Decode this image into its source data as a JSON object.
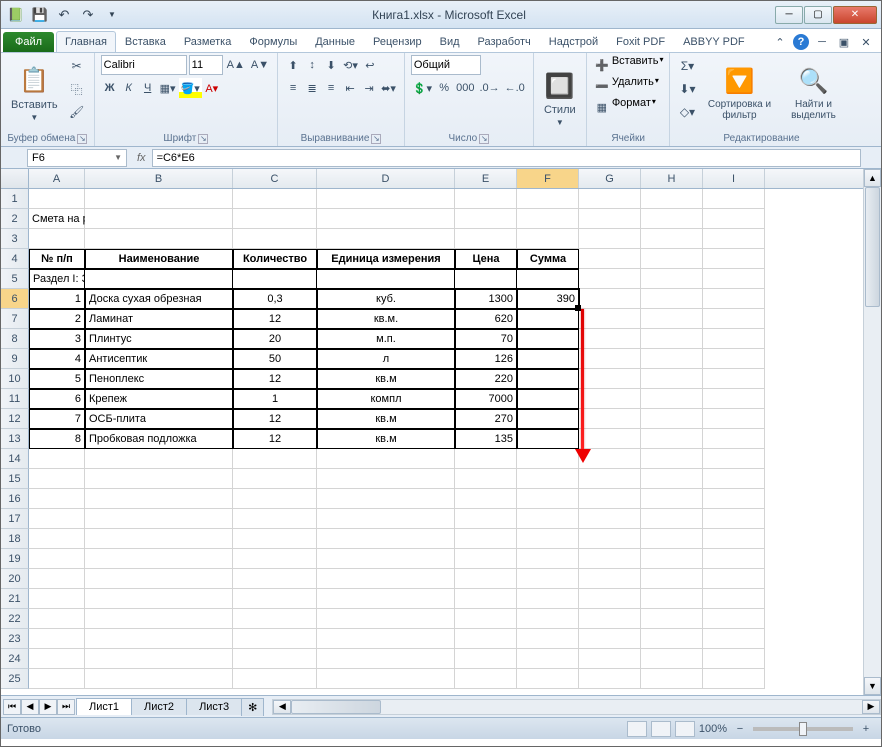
{
  "window": {
    "title": "Книга1.xlsx - Microsoft Excel"
  },
  "tabs": {
    "file": "Файл",
    "items": [
      "Главная",
      "Вставка",
      "Разметка",
      "Формулы",
      "Данные",
      "Рецензир",
      "Вид",
      "Разработч",
      "Надстрой",
      "Foxit PDF",
      "ABBYY PDF"
    ],
    "active": 0
  },
  "ribbon": {
    "clipboard": {
      "paste": "Вставить",
      "label": "Буфер обмена"
    },
    "font": {
      "name": "Calibri",
      "size": "11",
      "label": "Шрифт"
    },
    "alignment": {
      "label": "Выравнивание"
    },
    "number": {
      "format": "Общий",
      "label": "Число"
    },
    "styles": {
      "btn": "Стили",
      "label": ""
    },
    "cells": {
      "insert": "Вставить",
      "delete": "Удалить",
      "format": "Формат",
      "label": "Ячейки"
    },
    "editing": {
      "sort": "Сортировка и фильтр",
      "find": "Найти и выделить",
      "label": "Редактирование"
    }
  },
  "namebox": "F6",
  "formula": "=C6*E6",
  "columns": [
    "A",
    "B",
    "C",
    "D",
    "E",
    "F",
    "G",
    "H",
    "I"
  ],
  "selected_col": "F",
  "selected_row": 6,
  "sheet": {
    "title_row": 2,
    "title": "Смета на работы",
    "header_row": 4,
    "headers": [
      "№ п/п",
      "Наименование",
      "Количество",
      "Единица измерения",
      "Цена",
      "Сумма"
    ],
    "section_row": 5,
    "section": "Раздел I: Затраты на материалы",
    "data": [
      {
        "n": "1",
        "name": "Доска сухая обрезная",
        "qty": "0,3",
        "unit": "куб.",
        "price": "1300",
        "sum": "390"
      },
      {
        "n": "2",
        "name": "Ламинат",
        "qty": "12",
        "unit": "кв.м.",
        "price": "620",
        "sum": ""
      },
      {
        "n": "3",
        "name": "Плинтус",
        "qty": "20",
        "unit": "м.п.",
        "price": "70",
        "sum": ""
      },
      {
        "n": "4",
        "name": "Антисептик",
        "qty": "50",
        "unit": "л",
        "price": "126",
        "sum": ""
      },
      {
        "n": "5",
        "name": "Пеноплекс",
        "qty": "12",
        "unit": "кв.м",
        "price": "220",
        "sum": ""
      },
      {
        "n": "6",
        "name": "Крепеж",
        "qty": "1",
        "unit": "компл",
        "price": "7000",
        "sum": ""
      },
      {
        "n": "7",
        "name": "ОСБ-плита",
        "qty": "12",
        "unit": "кв.м",
        "price": "270",
        "sum": ""
      },
      {
        "n": "8",
        "name": "Пробковая подложка",
        "qty": "12",
        "unit": "кв.м",
        "price": "135",
        "sum": ""
      }
    ]
  },
  "sheets": [
    "Лист1",
    "Лист2",
    "Лист3"
  ],
  "active_sheet": 0,
  "status": {
    "ready": "Готово",
    "zoom": "100%"
  },
  "chart_data": {
    "type": "table",
    "title": "Смета на работы — Раздел I: Затраты на материалы",
    "columns": [
      "№ п/п",
      "Наименование",
      "Количество",
      "Единица измерения",
      "Цена",
      "Сумма"
    ],
    "rows": [
      [
        1,
        "Доска сухая обрезная",
        0.3,
        "куб.",
        1300,
        390
      ],
      [
        2,
        "Ламинат",
        12,
        "кв.м.",
        620,
        null
      ],
      [
        3,
        "Плинтус",
        20,
        "м.п.",
        70,
        null
      ],
      [
        4,
        "Антисептик",
        50,
        "л",
        126,
        null
      ],
      [
        5,
        "Пеноплекс",
        12,
        "кв.м",
        220,
        null
      ],
      [
        6,
        "Крепеж",
        1,
        "компл",
        7000,
        null
      ],
      [
        7,
        "ОСБ-плита",
        12,
        "кв.м",
        270,
        null
      ],
      [
        8,
        "Пробковая подложка",
        12,
        "кв.м",
        135,
        null
      ]
    ]
  }
}
